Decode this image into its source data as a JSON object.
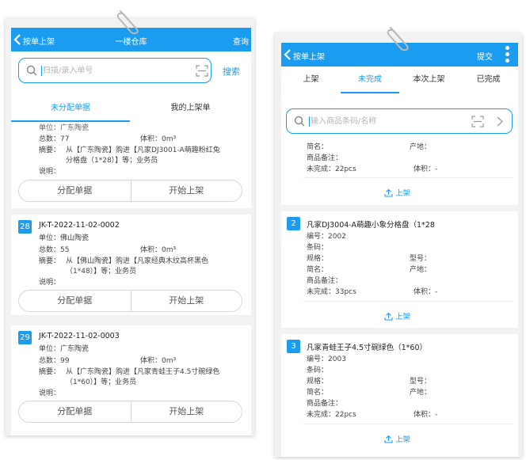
{
  "left": {
    "appbar": {
      "back_label": "按单上架",
      "title": "一楼仓库",
      "action": "查询"
    },
    "search": {
      "placeholder": "扫描/录入单号",
      "button": "搜索"
    },
    "tabs": [
      {
        "label": "未分配单据",
        "active": true
      },
      {
        "label": "我的上架单",
        "active": false
      }
    ],
    "partial_card": {
      "unit_text": "单位：广东陶瓷",
      "total_label": "总数：",
      "total_value": "77",
      "volume_label": "体积：",
      "volume_value": "0m³",
      "summary_label": "摘要：",
      "summary_line1": "从【广东陶瓷】购进【凡家DJ3001-A萌趣粉红兔",
      "summary_line2": "分格盘（1*28）】等；业务员",
      "note_label": "说明：",
      "btn_assign": "分配单据",
      "btn_start": "开始上架"
    },
    "cards": [
      {
        "index": "28",
        "code": "JK-T-2022-11-02-0002",
        "unit_label": "单位：",
        "unit_value": "佛山陶瓷",
        "total_label": "总数：",
        "total_value": "55",
        "volume_label": "体积：",
        "volume_value": "0m³",
        "summary_label": "摘要：",
        "summary_line1": "从【佛山陶瓷】购进【凡家经典木纹高杯黑色",
        "summary_line2": "（1*48）】等；业务员",
        "note_label": "说明：",
        "btn_assign": "分配单据",
        "btn_start": "开始上架"
      },
      {
        "index": "29",
        "code": "JK-T-2022-11-02-0003",
        "unit_label": "单位：",
        "unit_value": "广东陶瓷",
        "total_label": "总数：",
        "total_value": "99",
        "volume_label": "体积：",
        "volume_value": "0m³",
        "summary_label": "摘要：",
        "summary_line1": "从【广东陶瓷】购进【凡家青蛙王子4.5寸碗绿色",
        "summary_line2": "（1*60）】等；业务员",
        "note_label": "说明：",
        "btn_assign": "分配单据",
        "btn_start": "开始上架"
      }
    ]
  },
  "right": {
    "appbar": {
      "back_label": "按单上架",
      "action": "提交"
    },
    "tabs": [
      {
        "label": "上架",
        "active": false
      },
      {
        "label": "未完成",
        "active": true
      },
      {
        "label": "本次上架",
        "active": false
      },
      {
        "label": "已完成",
        "active": false
      }
    ],
    "search": {
      "placeholder": "输入商品条码/名称"
    },
    "partial_item": {
      "location_label": "简名：",
      "origin_label": "产地：",
      "goods_note_label": "商品备注：",
      "unfinished_label": "未完成：",
      "unfinished_value": "22pcs",
      "volume_label": "体积：",
      "volume_value": "-",
      "up_label": "上架"
    },
    "items": [
      {
        "index": "2",
        "name": "凡家DJ3004-A萌趣小象分格盘（1*28",
        "code_label": "编号：",
        "code_value": "2002",
        "barcode_label": "条码：",
        "spec_label": "规格：",
        "model_label": "型号：",
        "short_label": "简名：",
        "origin_label": "产地：",
        "goods_note_label": "商品备注：",
        "unfinished_label": "未完成：",
        "unfinished_value": "33pcs",
        "volume_label": "体积：",
        "volume_value": "-",
        "up_label": "上架"
      },
      {
        "index": "3",
        "name": "凡家青蛙王子4.5寸碗绿色（1*60）",
        "code_label": "编号：",
        "code_value": "2003",
        "barcode_label": "条码：",
        "spec_label": "规格：",
        "model_label": "型号：",
        "short_label": "简名：",
        "origin_label": "产地：",
        "goods_note_label": "商品备注：",
        "unfinished_label": "未完成：",
        "unfinished_value": "22pcs",
        "volume_label": "体积：",
        "volume_value": "-",
        "up_label": "上架"
      }
    ]
  },
  "colors": {
    "accent": "#1a9cf0",
    "background": "#f2f2f2",
    "card": "#ffffff"
  },
  "icons": [
    "paperclip-icon",
    "back-arrow-icon",
    "search-icon",
    "scan-icon",
    "chevron-right-icon",
    "more-vertical-icon",
    "upload-icon"
  ]
}
